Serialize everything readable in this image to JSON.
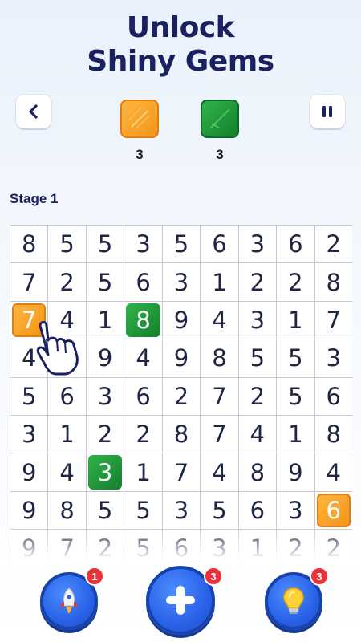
{
  "header": {
    "title_line1": "Unlock",
    "title_line2": "Shiny Gems"
  },
  "toolbar": {
    "back_icon": "chevron-left-icon",
    "pause_icon": "pause-icon"
  },
  "goals": {
    "orange": {
      "count": "3",
      "color": "#f5a224"
    },
    "green": {
      "count": "3",
      "color": "#1f9a3a"
    }
  },
  "stage_label": "Stage 1",
  "grid": {
    "rows": [
      [
        "8",
        "5",
        "5",
        "3",
        "5",
        "6",
        "3",
        "6",
        "2"
      ],
      [
        "7",
        "2",
        "5",
        "6",
        "3",
        "1",
        "2",
        "2",
        "8"
      ],
      [
        "7",
        "4",
        "1",
        "8",
        "9",
        "4",
        "3",
        "1",
        "7"
      ],
      [
        "4",
        "",
        "9",
        "4",
        "9",
        "8",
        "5",
        "5",
        "3"
      ],
      [
        "5",
        "6",
        "3",
        "6",
        "2",
        "7",
        "2",
        "5",
        "6"
      ],
      [
        "3",
        "1",
        "2",
        "2",
        "8",
        "7",
        "4",
        "1",
        "8"
      ],
      [
        "9",
        "4",
        "3",
        "1",
        "7",
        "4",
        "8",
        "9",
        "4"
      ],
      [
        "9",
        "8",
        "5",
        "5",
        "3",
        "5",
        "6",
        "3",
        "6"
      ],
      [
        "9",
        "7",
        "2",
        "5",
        "6",
        "3",
        "1",
        "2",
        "2"
      ]
    ],
    "gems": [
      {
        "row": 2,
        "col": 0,
        "type": "orange"
      },
      {
        "row": 2,
        "col": 3,
        "type": "green"
      },
      {
        "row": 6,
        "col": 2,
        "type": "green"
      },
      {
        "row": 7,
        "col": 8,
        "type": "orange"
      }
    ]
  },
  "boosters": {
    "rocket": {
      "badge": "1",
      "icon": "rocket-icon"
    },
    "add": {
      "badge": "3",
      "icon": "plus-icon"
    },
    "hint": {
      "badge": "3",
      "icon": "lightbulb-icon"
    }
  },
  "colors": {
    "accent": "#2962e8",
    "badge": "#e9323a",
    "title": "#1a2160"
  }
}
